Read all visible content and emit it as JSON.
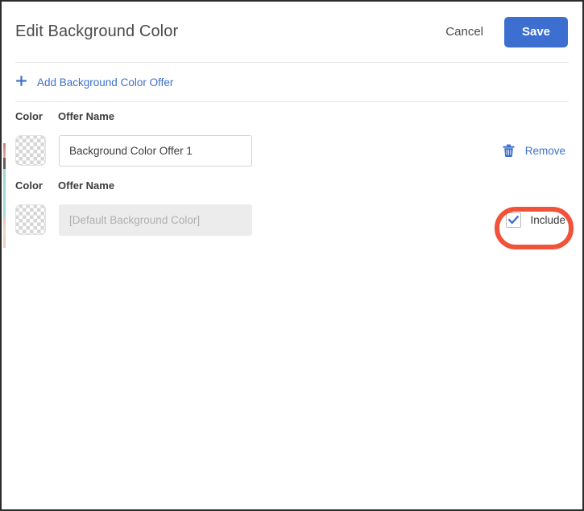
{
  "header": {
    "title": "Edit Background Color",
    "cancel_label": "Cancel",
    "save_label": "Save"
  },
  "toolbar": {
    "add_offer_label": "Add Background Color Offer",
    "add_icon": "plus-icon"
  },
  "table": {
    "columns": {
      "color": "Color",
      "offer_name": "Offer Name"
    },
    "rows": [
      {
        "swatch": "transparent-checkerboard",
        "offer_name_value": "Background Color Offer 1",
        "offer_name_placeholder": "",
        "disabled": false,
        "action": {
          "type": "remove",
          "icon": "trash-icon",
          "label": "Remove"
        }
      },
      {
        "swatch": "transparent-checkerboard",
        "offer_name_value": "",
        "offer_name_placeholder": "[Default Background Color]",
        "disabled": true,
        "action": {
          "type": "include",
          "icon": "checkmark-icon",
          "label": "Include",
          "checked": true
        }
      }
    ]
  },
  "annotation": {
    "shape": "rounded-rectangle-highlight",
    "color": "#f0533a",
    "targets": "include-checkbox"
  },
  "colors": {
    "accent_blue": "#3d6fd0",
    "link_blue": "#3d6fd0",
    "annotation_red": "#f0533a",
    "text_dark": "#3c3c3c",
    "title_gray": "#4b4b4b",
    "divider": "#e6e6e6",
    "disabled_field": "#ececec",
    "checker_gray": "#d6d6d6"
  }
}
